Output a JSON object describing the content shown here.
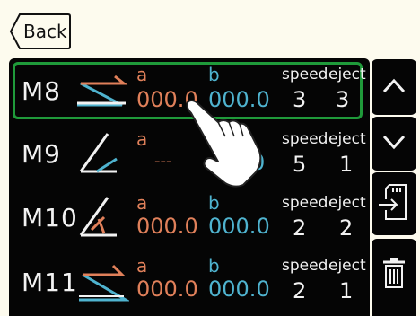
{
  "header": {
    "back_label": "Back"
  },
  "rows": [
    {
      "name": "M8",
      "a_label": "a",
      "b_label": "b",
      "a_value": "000.0",
      "b_value": "000.0",
      "speed_label": "speed",
      "eject_label": "eject",
      "speed": "3",
      "eject": "3",
      "selected": true
    },
    {
      "name": "M9",
      "a_label": "a",
      "a_value": "---",
      "b_value": "0",
      "speed_label": "speed",
      "eject_label": "eject",
      "speed": "5",
      "eject": "1"
    },
    {
      "name": "M10",
      "a_label": "a",
      "b_label": "b",
      "a_value": "000.0",
      "b_value": "000.0",
      "speed_label": "speed",
      "eject_label": "eject",
      "speed": "2",
      "eject": "2"
    },
    {
      "name": "M11",
      "a_label": "a",
      "b_label": "b",
      "a_value": "000.0",
      "b_value": "000.0",
      "speed_label": "speed",
      "eject_label": "eject",
      "speed": "2",
      "eject": "1"
    }
  ],
  "sidebar": {
    "buttons": [
      {
        "icon": "chevron-up-icon"
      },
      {
        "icon": "chevron-down-icon"
      },
      {
        "icon": "import-file-icon"
      },
      {
        "icon": "trash-icon"
      }
    ]
  },
  "colors": {
    "a_accent": "#e0805a",
    "b_accent": "#4fb3cf",
    "selection": "#1f9a3a",
    "background": "#fdfbee"
  }
}
